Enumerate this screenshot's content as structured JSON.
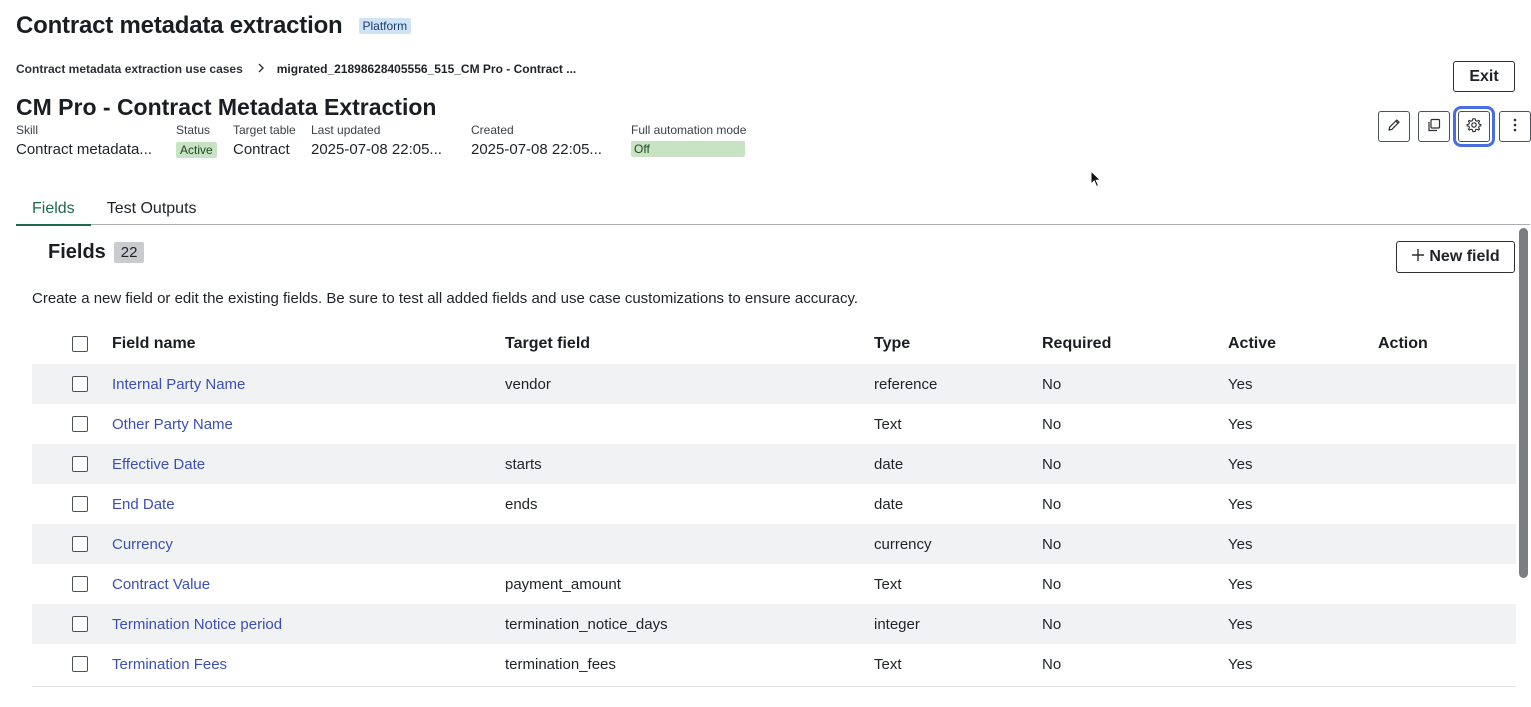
{
  "header": {
    "app_title": "Contract metadata extraction",
    "platform_badge": "Platform",
    "exit_label": "Exit"
  },
  "breadcrumb": {
    "parent": "Contract metadata extraction use cases",
    "current": "migrated_21898628405556_515_CM Pro - Contract ..."
  },
  "record": {
    "title": "CM Pro - Contract Metadata Extraction",
    "meta": {
      "skill_label": "Skill",
      "skill_value": "Contract metadata...",
      "status_label": "Status",
      "status_value": "Active",
      "target_table_label": "Target table",
      "target_table_value": "Contract",
      "last_updated_label": "Last updated",
      "last_updated_value": "2025-07-08 22:05...",
      "created_label": "Created",
      "created_value": "2025-07-08 22:05...",
      "full_automation_label": "Full automation mode",
      "full_automation_value": "Off"
    }
  },
  "toolbar_icons": [
    "pencil-icon",
    "copy-icon",
    "gear-icon",
    "more-vertical-icon"
  ],
  "tabs": [
    {
      "label": "Fields",
      "active": true
    },
    {
      "label": "Test Outputs",
      "active": false
    }
  ],
  "fields_section": {
    "heading": "Fields",
    "count": "22",
    "new_field_label": "New field",
    "description": "Create a new field or edit the existing fields. Be sure to test all added fields and use case customizations to ensure accuracy."
  },
  "table": {
    "columns": [
      "Field name",
      "Target field",
      "Type",
      "Required",
      "Active",
      "Action"
    ],
    "rows": [
      {
        "name": "Internal Party Name",
        "target": "vendor",
        "type": "reference",
        "required": "No",
        "active": "Yes"
      },
      {
        "name": "Other Party Name",
        "target": "",
        "type": "Text",
        "required": "No",
        "active": "Yes"
      },
      {
        "name": "Effective Date",
        "target": "starts",
        "type": "date",
        "required": "No",
        "active": "Yes"
      },
      {
        "name": "End Date",
        "target": "ends",
        "type": "date",
        "required": "No",
        "active": "Yes"
      },
      {
        "name": "Currency",
        "target": "",
        "type": "currency",
        "required": "No",
        "active": "Yes"
      },
      {
        "name": "Contract Value",
        "target": "payment_amount",
        "type": "Text",
        "required": "No",
        "active": "Yes"
      },
      {
        "name": "Termination Notice period",
        "target": "termination_notice_days",
        "type": "integer",
        "required": "No",
        "active": "Yes"
      },
      {
        "name": "Termination Fees",
        "target": "termination_fees",
        "type": "Text",
        "required": "No",
        "active": "Yes"
      }
    ]
  },
  "colors": {
    "link": "#3b4fb5",
    "tab_active": "#1d6a4e",
    "status_green": "#c7e3c4",
    "platform_blue": "#cfe3f7",
    "focus_ring": "#4a6de0"
  }
}
